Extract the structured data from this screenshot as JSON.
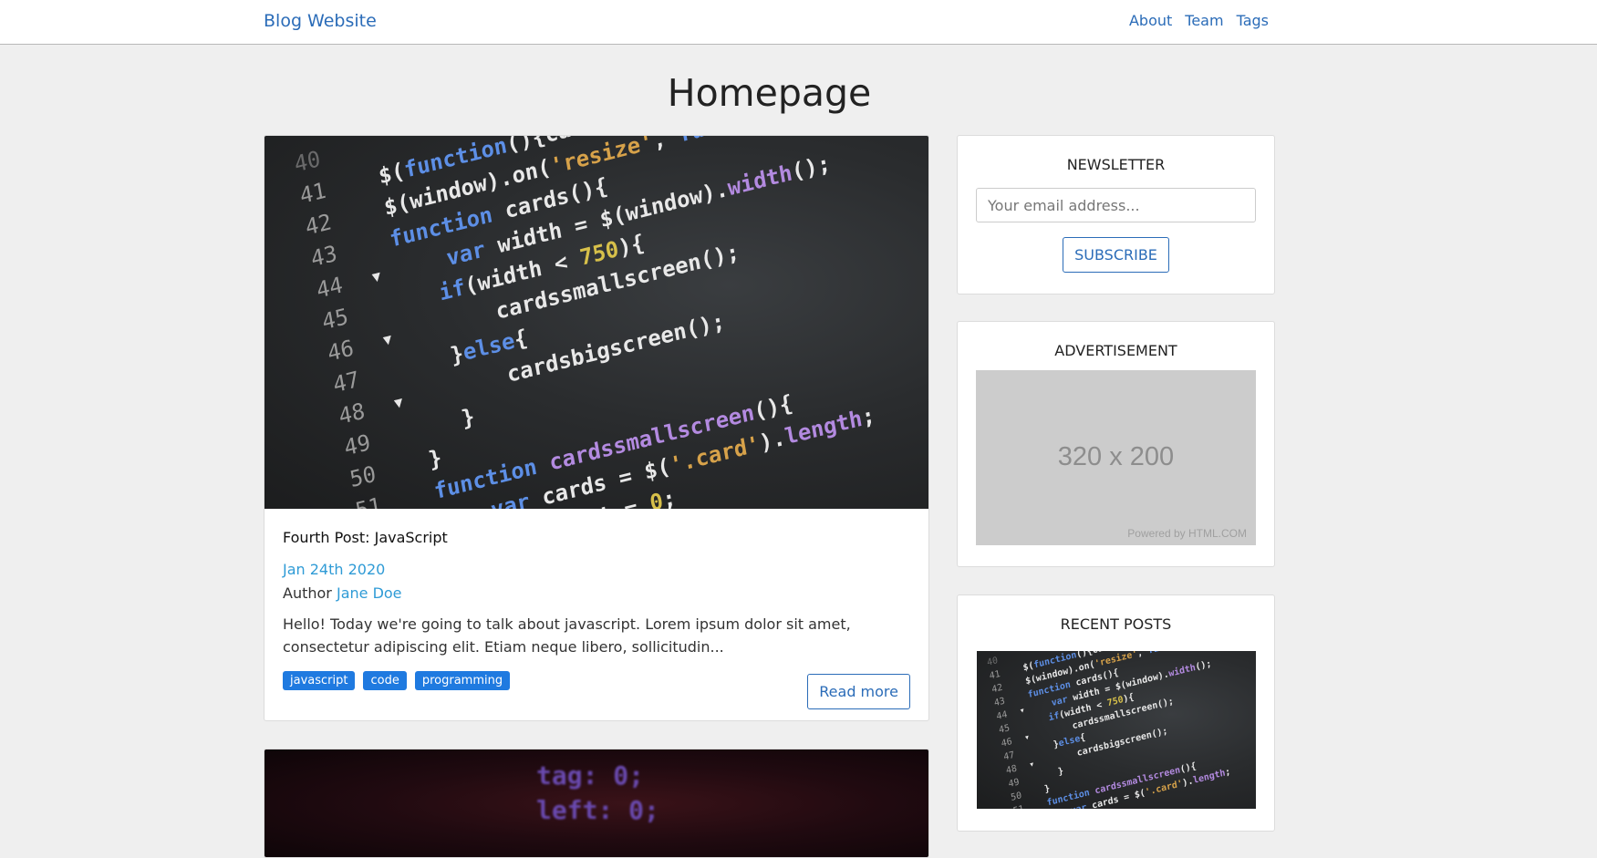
{
  "nav": {
    "brand": "Blog Website",
    "links": [
      "About",
      "Team",
      "Tags"
    ]
  },
  "page": {
    "title": "Homepage"
  },
  "posts": [
    {
      "title": "Fourth Post: JavaScript",
      "date": "Jan 24th 2020",
      "author_label": "Author",
      "author": "Jane Doe",
      "excerpt": "Hello! Today we're going to talk about javascript. Lorem ipsum dolor sit amet, consectetur adipiscing elit. Etiam neque libero, sollicitudin...",
      "tags": [
        "javascript",
        "code",
        "programming"
      ],
      "read_more": "Read more"
    }
  ],
  "sidebar": {
    "newsletter": {
      "title": "NEWSLETTER",
      "placeholder": "Your email address...",
      "button": "SUBSCRIBE"
    },
    "advertisement": {
      "title": "ADVERTISEMENT",
      "size_text": "320 x 200",
      "powered": "Powered by HTML.COM"
    },
    "recent_posts": {
      "title": "RECENT POSTS"
    }
  },
  "colors": {
    "link": "#2b6cb8",
    "date": "#2f9bd6",
    "tag_bg": "#1f7ae0",
    "page_bg": "#efefef"
  }
}
